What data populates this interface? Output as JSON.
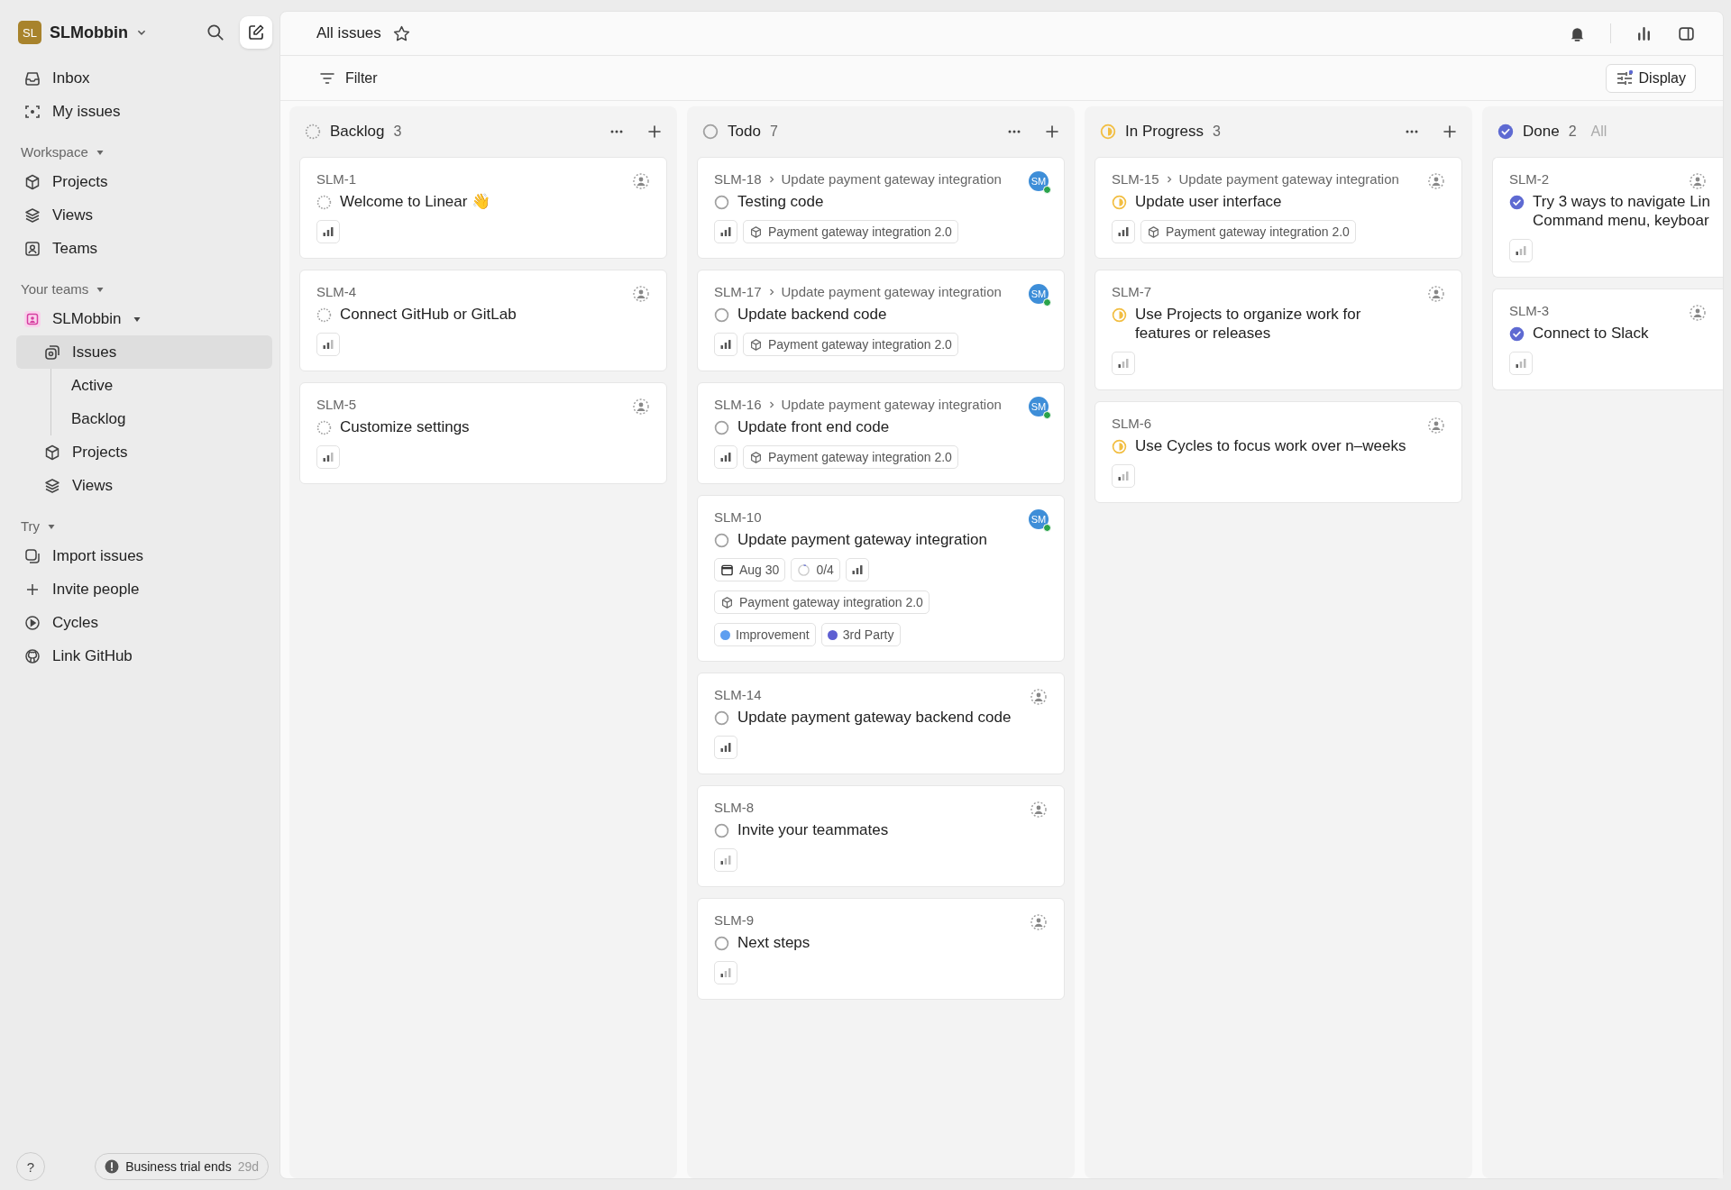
{
  "workspace": {
    "initials": "SL",
    "name": "SLMobbin"
  },
  "nav": [
    {
      "label": "Inbox",
      "selected": false
    },
    {
      "label": "My issues",
      "selected": false
    }
  ],
  "workspace_section": {
    "title": "Workspace",
    "items": [
      {
        "label": "Projects",
        "selected": false
      },
      {
        "label": "Views",
        "selected": false
      },
      {
        "label": "Teams",
        "selected": false
      }
    ]
  },
  "teams_section": {
    "title": "Your teams",
    "team": {
      "name": "SLMobbin",
      "expanded": true,
      "children": [
        {
          "label": "Issues",
          "selected": true,
          "children": [
            {
              "label": "Active",
              "selected": false
            },
            {
              "label": "Backlog",
              "selected": false
            }
          ]
        },
        {
          "label": "Projects",
          "selected": false
        },
        {
          "label": "Views",
          "selected": false
        }
      ]
    }
  },
  "try_section": {
    "title": "Try",
    "items": [
      {
        "label": "Import issues",
        "selected": false
      },
      {
        "label": "Invite people",
        "selected": false
      },
      {
        "label": "Cycles",
        "selected": false
      },
      {
        "label": "Link GitHub",
        "selected": false
      }
    ]
  },
  "help": "?",
  "trial": {
    "label": "Business trial ends",
    "days": "29d"
  },
  "header": {
    "title": "All issues"
  },
  "filter": "Filter",
  "display": "Display",
  "columns": [
    {
      "name": "Backlog",
      "count": "3",
      "kind": "backlog",
      "cards": [
        {
          "id": "SLM-1",
          "title_lines": [
            "Welcome to Linear 👋"
          ],
          "priority": {
            "kind": "high"
          }
        },
        {
          "id": "SLM-4",
          "title_lines": [
            "Connect GitHub or GitLab"
          ],
          "priority": {
            "kind": "medium"
          }
        },
        {
          "id": "SLM-5",
          "title_lines": [
            "Customize settings"
          ],
          "priority": {
            "kind": "medium"
          }
        }
      ]
    },
    {
      "name": "Todo",
      "count": "7",
      "kind": "todo",
      "cards": [
        {
          "id": "SLM-18",
          "parent": "Update payment gateway integration",
          "title_lines": [
            "Testing code"
          ],
          "priority": {
            "kind": "high"
          },
          "assignee": "SM",
          "project": "Payment gateway integration 2.0"
        },
        {
          "id": "SLM-17",
          "parent": "Update payment gateway integration",
          "title_lines": [
            "Update backend code"
          ],
          "priority": {
            "kind": "high"
          },
          "assignee": "SM",
          "project": "Payment gateway integration 2.0"
        },
        {
          "id": "SLM-16",
          "parent": "Update payment gateway integration",
          "title_lines": [
            "Update front end code"
          ],
          "priority": {
            "kind": "high"
          },
          "assignee": "SM",
          "project": "Payment gateway integration 2.0"
        },
        {
          "id": "SLM-10",
          "title_lines": [
            "Update payment gateway integration"
          ],
          "priority": {
            "kind": "high"
          },
          "assignee": "SM",
          "due": "Aug 30",
          "subtasks": "0/4",
          "project": "Payment gateway integration 2.0",
          "labels": [
            {
              "name": "Improvement",
              "color": "#5e9ff0"
            },
            {
              "name": "3rd Party",
              "color": "#5e5fd2"
            }
          ]
        },
        {
          "id": "SLM-14",
          "title_lines": [
            "Update payment gateway backend code"
          ],
          "priority": {
            "kind": "high"
          }
        },
        {
          "id": "SLM-8",
          "title_lines": [
            "Invite your teammates"
          ],
          "priority": {
            "kind": "low"
          }
        },
        {
          "id": "SLM-9",
          "title_lines": [
            "Next steps"
          ],
          "priority": {
            "kind": "low"
          }
        }
      ]
    },
    {
      "name": "In Progress",
      "count": "3",
      "kind": "in_progress",
      "cards": [
        {
          "id": "SLM-15",
          "parent": "Update payment gateway integration",
          "title_lines": [
            "Update user interface"
          ],
          "priority": {
            "kind": "high"
          },
          "project": "Payment gateway integration 2.0"
        },
        {
          "id": "SLM-7",
          "title_lines": [
            "Use Projects to organize work for",
            "features or releases"
          ],
          "priority": {
            "kind": "low"
          }
        },
        {
          "id": "SLM-6",
          "title_lines": [
            "Use Cycles to focus work over n–weeks"
          ],
          "priority": {
            "kind": "low"
          }
        }
      ]
    },
    {
      "name": "Done",
      "count": "2",
      "extra": "All",
      "kind": "done",
      "cards": [
        {
          "id": "SLM-2",
          "title_lines": [
            "Try 3 ways to navigate Lin",
            "Command menu, keyboar"
          ],
          "priority": {
            "kind": "low"
          }
        },
        {
          "id": "SLM-3",
          "title_lines": [
            "Connect to Slack"
          ],
          "priority": {
            "kind": "low"
          }
        }
      ]
    }
  ]
}
